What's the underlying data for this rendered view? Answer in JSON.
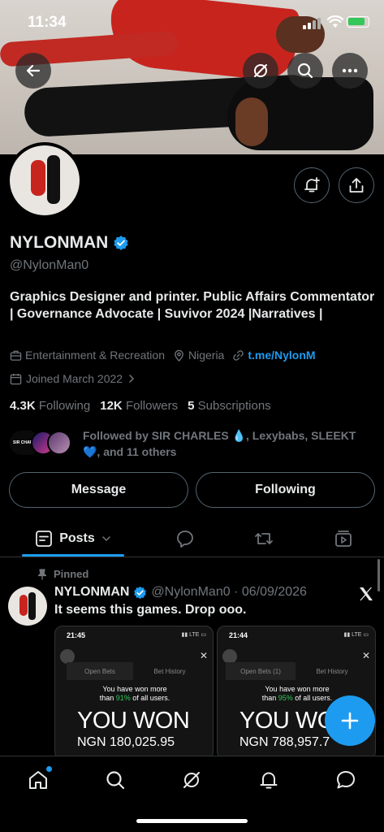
{
  "status_bar": {
    "time": "11:34"
  },
  "profile": {
    "name": "NYLONMAN",
    "handle": "@NylonMan0",
    "bio": "Graphics Designer and printer. Public Affairs Commentator | Governance Advocate | Suvivor 2024 |Narratives |",
    "category": "Entertainment & Recreation",
    "location": "Nigeria",
    "link": "t.me/NylonM",
    "joined": "Joined March 2022",
    "following_count": "4.3K",
    "following_label": "Following",
    "followers_count": "12K",
    "followers_label": "Followers",
    "subscriptions_count": "5",
    "subscriptions_label": "Subscriptions",
    "followed_by": "Followed by SIR CHARLES 💧, Lexybabs, SLEEKT💙, and 11 others",
    "mini_avatar_label": "SIR CHARLES"
  },
  "actions": {
    "message_label": "Message",
    "following_label": "Following"
  },
  "tabs": {
    "posts_label": "Posts"
  },
  "post": {
    "pinned_label": "Pinned",
    "author": "NYLONMAN",
    "handle_date": "@NylonMan0 · 06/09/2026",
    "text": "It seems this games. Drop ooo.",
    "images": [
      {
        "time": "21:45",
        "won_line1": "You have won more",
        "won_line2_pre": "than ",
        "won_pct": "91%",
        "won_line2_post": " of all users.",
        "headline": "YOU WON",
        "amount": "NGN 180,025.95",
        "tab1": "Open Bets",
        "tab2": "Bet History"
      },
      {
        "time": "21:44",
        "won_line1": "You have won more",
        "won_line2_pre": "than ",
        "won_pct": "95%",
        "won_line2_post": " of all users.",
        "headline": "YOU WO",
        "amount": "NGN 788,957.7",
        "tab1": "Open Bets (1)",
        "tab2": "Bet History"
      }
    ]
  },
  "colors": {
    "accent": "#1d9bf0",
    "muted": "#71767b",
    "text": "#e7e9ea",
    "border": "#536471",
    "verified": "#1d9bf0"
  }
}
